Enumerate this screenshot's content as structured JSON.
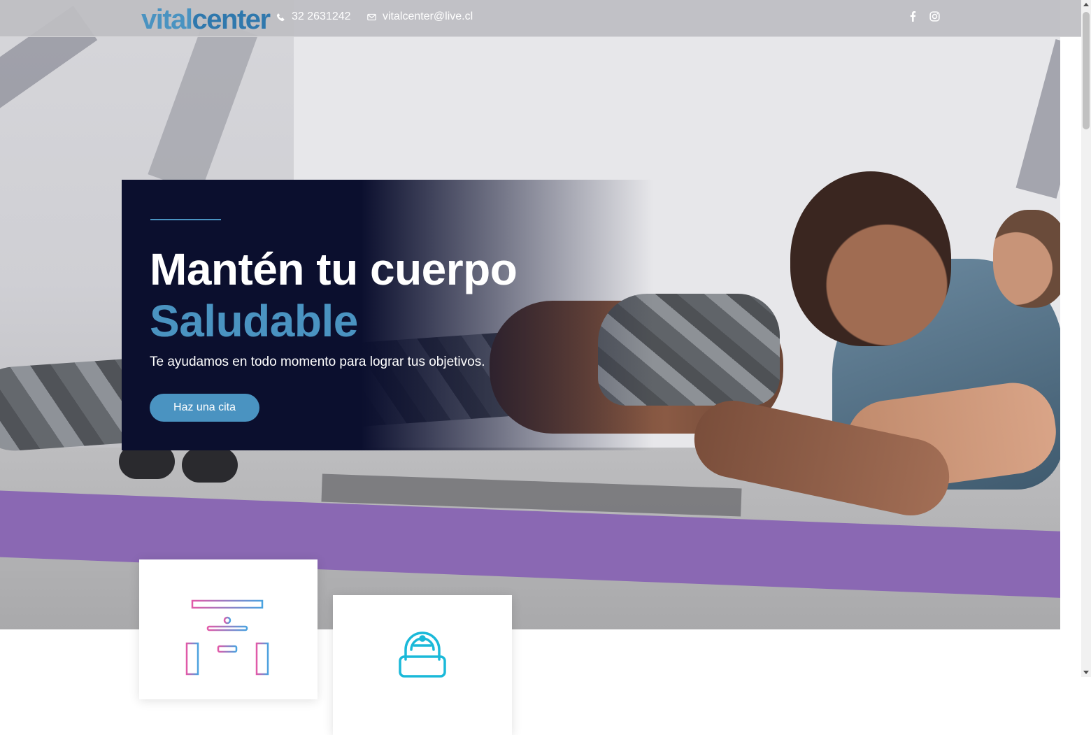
{
  "header": {
    "logo_part1": "vital",
    "logo_part2": "center",
    "phone": "32 2631242",
    "email": "vitalcenter@live.cl",
    "phone_icon": "phone-icon",
    "email_icon": "envelope-icon",
    "social": [
      "facebook-icon",
      "instagram-icon"
    ]
  },
  "hero": {
    "title": "Mantén tu cuerpo",
    "title_accent": "Saludable",
    "subtitle": "Te ayudamos en todo momento para lograr tus objetivos.",
    "cta_label": "Haz una cita"
  },
  "services": {
    "items": [
      {
        "icon": "gym-machine-icon"
      },
      {
        "icon": "robot-icon"
      }
    ]
  },
  "colors": {
    "accent": "#4a93c1",
    "card_bg": "#0b0f2e",
    "gradient_pink": "#e25aa8",
    "gradient_blue": "#4aa3e0",
    "robot_cyan": "#1ab9d9"
  }
}
